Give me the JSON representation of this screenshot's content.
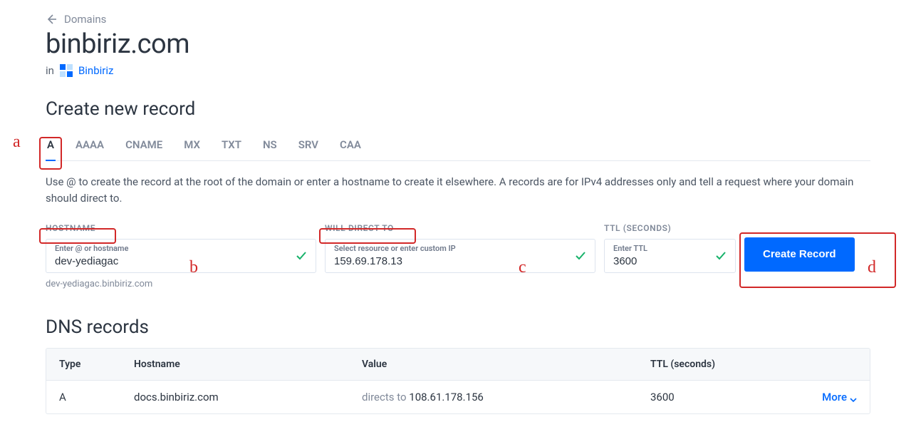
{
  "back": {
    "label": "Domains"
  },
  "page_title": "binbiriz.com",
  "project": {
    "prefix": "in",
    "name": "Binbiriz"
  },
  "create": {
    "heading": "Create new record",
    "tabs": [
      "A",
      "AAAA",
      "CNAME",
      "MX",
      "TXT",
      "NS",
      "SRV",
      "CAA"
    ],
    "active_tab": "A",
    "description": "Use @ to create the record at the root of the domain or enter a hostname to create it elsewhere. A records are for IPv4 addresses only and tell a request where your domain should direct to.",
    "hostname": {
      "label": "HOSTNAME",
      "inner_label": "Enter @ or hostname",
      "value": "dev-yediagac",
      "hint": "dev-yediagac.binbiriz.com"
    },
    "direct_to": {
      "label": "WILL DIRECT TO",
      "inner_label": "Select resource or enter custom IP",
      "value": "159.69.178.13"
    },
    "ttl": {
      "label": "TTL (SECONDS)",
      "inner_label": "Enter TTL",
      "value": "3600"
    },
    "button": "Create Record"
  },
  "dns": {
    "heading": "DNS records",
    "columns": {
      "type": "Type",
      "host": "Hostname",
      "value": "Value",
      "ttl": "TTL (seconds)"
    },
    "more_label": "More",
    "rows": [
      {
        "type": "A",
        "host": "docs.binbiriz.com",
        "value_prefix": "directs to ",
        "value": "108.61.178.156",
        "ttl": "3600"
      }
    ]
  },
  "annotations": {
    "a": "a",
    "b": "b",
    "c": "c",
    "d": "d"
  }
}
